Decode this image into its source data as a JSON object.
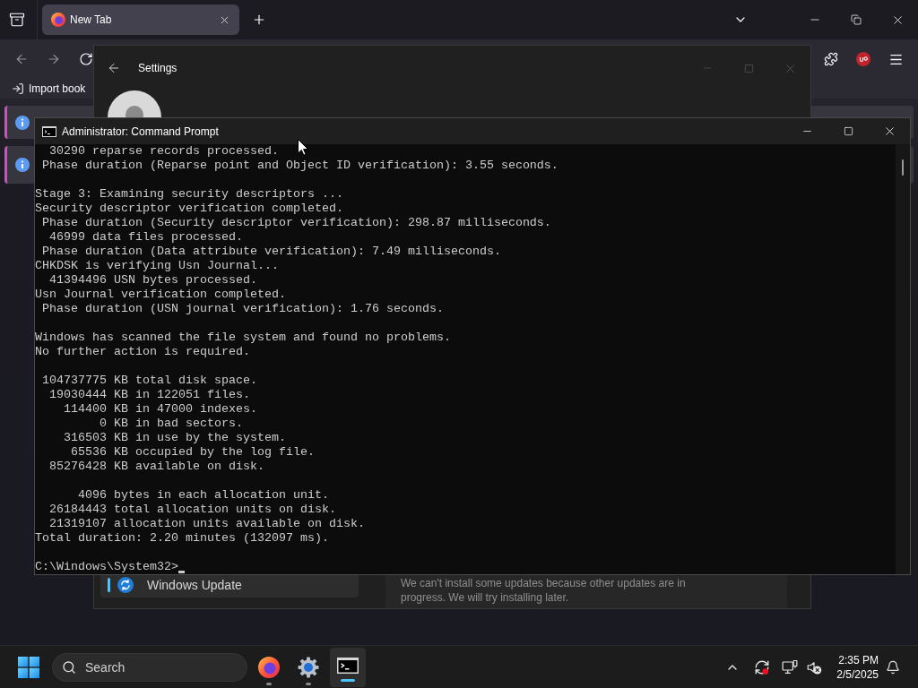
{
  "browser": {
    "tabs": [
      {
        "title": "New Tab",
        "selected": true
      }
    ],
    "bookmarks": [
      {
        "label": "Import book"
      }
    ]
  },
  "settings": {
    "title": "Settings",
    "nav_items": [
      {
        "label": "Windows Update",
        "selected": true
      }
    ],
    "message": "We can't install some updates because other updates are in progress. We will try installing later."
  },
  "terminal": {
    "title": "Administrator: Command Prompt",
    "blocks": [
      [
        "  30290 reparse records processed.",
        " Phase duration (Reparse point and Object ID verification): 3.55 seconds."
      ],
      [
        "Stage 3: Examining security descriptors ...",
        "Security descriptor verification completed.",
        " Phase duration (Security descriptor verification): 298.87 milliseconds.",
        "  46999 data files processed.",
        " Phase duration (Data attribute verification): 7.49 milliseconds.",
        "CHKDSK is verifying Usn Journal...",
        "  41394496 USN bytes processed.",
        "Usn Journal verification completed.",
        " Phase duration (USN journal verification): 1.76 seconds."
      ],
      [
        "Windows has scanned the file system and found no problems.",
        "No further action is required."
      ],
      [
        " 104737775 KB total disk space.",
        "  19030444 KB in 122051 files.",
        "    114400 KB in 47000 indexes.",
        "         0 KB in bad sectors.",
        "    316503 KB in use by the system.",
        "     65536 KB occupied by the log file.",
        "  85276428 KB available on disk."
      ],
      [
        "      4096 bytes in each allocation unit.",
        "  26184443 total allocation units on disk.",
        "  21319107 allocation units available on disk.",
        "Total duration: 2.20 minutes (132097 ms)."
      ]
    ],
    "prompt": "C:\\Windows\\System32>"
  },
  "taskbar": {
    "search": {
      "placeholder": "Search"
    },
    "apps": [
      {
        "kind": "browser",
        "selected": false
      },
      {
        "kind": "settings",
        "selected": false
      },
      {
        "kind": "terminal",
        "selected": true
      }
    ],
    "clock": {
      "time": "2:35 PM",
      "date": "2/5/2025"
    }
  }
}
